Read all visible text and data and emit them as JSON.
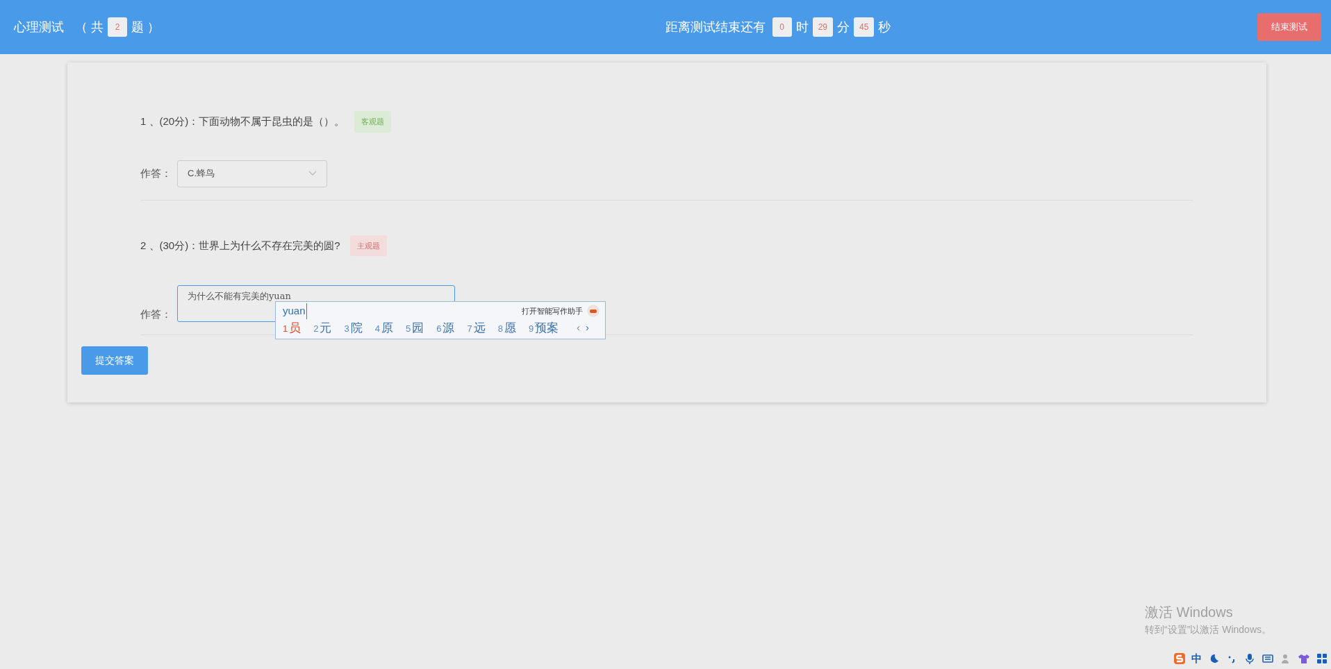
{
  "header": {
    "title": "心理测试",
    "count_prefix": "（ 共",
    "count": "2",
    "count_suffix": "题 ）",
    "timer_label": "距离测试结束还有",
    "timer": [
      {
        "value": "0",
        "unit": "时"
      },
      {
        "value": "29",
        "unit": "分"
      },
      {
        "value": "45",
        "unit": "秒"
      }
    ],
    "end_button": "结束测试"
  },
  "questions": [
    {
      "kind": "select",
      "text": "1 、(20分)：下面动物不属于昆虫的是（）。",
      "tag": "客观题",
      "color": "#dcebd6",
      "answer_label": "作答：",
      "value": "C.蜂鸟"
    },
    {
      "kind": "text",
      "text": "2 、(30分)：世界上为什么不存在完美的圆?",
      "tag": "主观题",
      "color": "#f3dcdc",
      "answer_label": "作答：",
      "value": "为什么不能有完美的yuan"
    }
  ],
  "submit_button": "提交答案",
  "ime": {
    "composition": "yuan",
    "assistant": "打开智能写作助手",
    "candidates": [
      {
        "index": "1",
        "text": "员",
        "selected": true
      },
      {
        "index": "2",
        "text": "元",
        "selected": false
      },
      {
        "index": "3",
        "text": "院",
        "selected": false
      },
      {
        "index": "4",
        "text": "原",
        "selected": false
      },
      {
        "index": "5",
        "text": "园",
        "selected": false
      },
      {
        "index": "6",
        "text": "源",
        "selected": false
      },
      {
        "index": "7",
        "text": "远",
        "selected": false
      },
      {
        "index": "8",
        "text": "愿",
        "selected": false
      },
      {
        "index": "9",
        "text": "预案",
        "selected": false
      }
    ],
    "prev": "‹",
    "next": "›"
  },
  "os_notice": {
    "title": "激活 Windows",
    "subtitle": "转到“设置”以激活 Windows。"
  },
  "tray": {
    "mode": "中"
  }
}
